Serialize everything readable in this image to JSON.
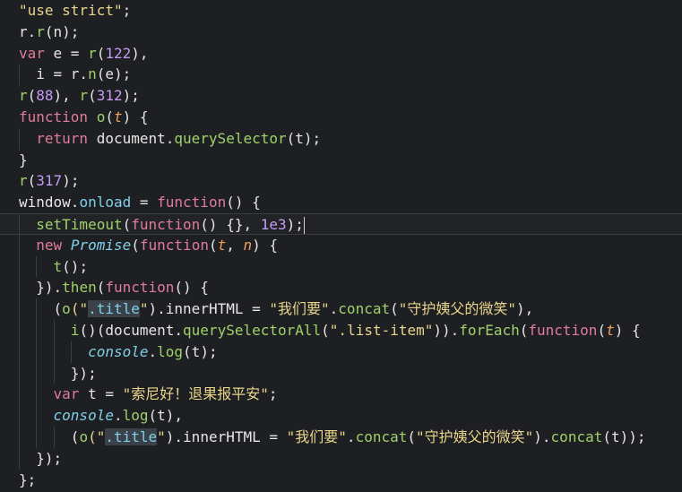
{
  "colors": {
    "background": "#1e1f22",
    "plain": "#e6e6e6",
    "keyword": "#e07c9b",
    "string": "#e8d58b",
    "number": "#c49bf2",
    "function": "#9fd26a",
    "property": "#7fd0e8",
    "param": "#f0a25b",
    "builtin": "#7fd0e8"
  },
  "editor": {
    "current_line_index": 10,
    "lines": [
      {
        "indent": 0,
        "tokens": [
          [
            "\"use strict\"",
            "string"
          ],
          [
            ";",
            "plain"
          ]
        ]
      },
      {
        "indent": 0,
        "tokens": [
          [
            "r.",
            "plain"
          ],
          [
            "r",
            "function"
          ],
          [
            "(n);",
            "plain"
          ]
        ]
      },
      {
        "indent": 0,
        "tokens": [
          [
            "var",
            "keyword"
          ],
          [
            " e = ",
            "plain"
          ],
          [
            "r",
            "function"
          ],
          [
            "(",
            "plain"
          ],
          [
            "122",
            "number"
          ],
          [
            "),",
            "plain"
          ]
        ]
      },
      {
        "indent": 1,
        "tokens": [
          [
            "  i = r.",
            "plain"
          ],
          [
            "n",
            "function"
          ],
          [
            "(e);",
            "plain"
          ]
        ]
      },
      {
        "indent": 0,
        "tokens": [
          [
            "r",
            "function"
          ],
          [
            "(",
            "plain"
          ],
          [
            "88",
            "number"
          ],
          [
            "), ",
            "plain"
          ],
          [
            "r",
            "function"
          ],
          [
            "(",
            "plain"
          ],
          [
            "312",
            "number"
          ],
          [
            ");",
            "plain"
          ]
        ]
      },
      {
        "indent": 0,
        "tokens": [
          [
            "function",
            "keyword"
          ],
          [
            " ",
            "plain"
          ],
          [
            "o",
            "function"
          ],
          [
            "(",
            "plain"
          ],
          [
            "t",
            "param"
          ],
          [
            ") {",
            "plain"
          ]
        ]
      },
      {
        "indent": 1,
        "tokens": [
          [
            "  ",
            "plain"
          ],
          [
            "return",
            "keyword"
          ],
          [
            " document.",
            "plain"
          ],
          [
            "querySelector",
            "function"
          ],
          [
            "(t);",
            "plain"
          ]
        ]
      },
      {
        "indent": 0,
        "tokens": [
          [
            "}",
            "plain"
          ]
        ]
      },
      {
        "indent": 0,
        "tokens": [
          [
            "r",
            "function"
          ],
          [
            "(",
            "plain"
          ],
          [
            "317",
            "number"
          ],
          [
            ");",
            "plain"
          ]
        ]
      },
      {
        "indent": 0,
        "tokens": [
          [
            "window.",
            "plain"
          ],
          [
            "onload",
            "property"
          ],
          [
            " = ",
            "plain"
          ],
          [
            "function",
            "keyword"
          ],
          [
            "() {",
            "plain"
          ]
        ]
      },
      {
        "indent": 1,
        "tokens": [
          [
            "  ",
            "plain"
          ],
          [
            "setTimeout",
            "function"
          ],
          [
            "(",
            "plain"
          ],
          [
            "function",
            "keyword"
          ],
          [
            "() {}, ",
            "plain"
          ],
          [
            "1e3",
            "number"
          ],
          [
            ");",
            "plain"
          ],
          [
            "|",
            "caret"
          ]
        ]
      },
      {
        "indent": 1,
        "tokens": [
          [
            "  ",
            "plain"
          ],
          [
            "new",
            "keyword"
          ],
          [
            " ",
            "plain"
          ],
          [
            "Promise",
            "builtin"
          ],
          [
            "(",
            "plain"
          ],
          [
            "function",
            "keyword"
          ],
          [
            "(",
            "plain"
          ],
          [
            "t",
            "param"
          ],
          [
            ", ",
            "plain"
          ],
          [
            "n",
            "param"
          ],
          [
            ") {",
            "plain"
          ]
        ]
      },
      {
        "indent": 2,
        "tokens": [
          [
            "    ",
            "plain"
          ],
          [
            "t",
            "function"
          ],
          [
            "();",
            "plain"
          ]
        ]
      },
      {
        "indent": 1,
        "tokens": [
          [
            "  }).",
            "plain"
          ],
          [
            "then",
            "function"
          ],
          [
            "(",
            "plain"
          ],
          [
            "function",
            "keyword"
          ],
          [
            "() {",
            "plain"
          ]
        ]
      },
      {
        "indent": 2,
        "tokens": [
          [
            "    (",
            "plain"
          ],
          [
            "o",
            "function"
          ],
          [
            "(\"",
            "string"
          ],
          [
            ".title",
            "sel"
          ],
          [
            "\"",
            "string"
          ],
          [
            ").innerHTML = ",
            "plain"
          ],
          [
            "\"我们要\"",
            "string"
          ],
          [
            ".",
            "plain"
          ],
          [
            "concat",
            "function"
          ],
          [
            "(",
            "plain"
          ],
          [
            "\"守护姨父的微笑\"",
            "string"
          ],
          [
            "),",
            "plain"
          ]
        ]
      },
      {
        "indent": 3,
        "tokens": [
          [
            "      ",
            "plain"
          ],
          [
            "i",
            "function"
          ],
          [
            "()(document.",
            "plain"
          ],
          [
            "querySelectorAll",
            "function"
          ],
          [
            "(",
            "plain"
          ],
          [
            "\".list-item\"",
            "string"
          ],
          [
            ")).",
            "plain"
          ],
          [
            "forEach",
            "function"
          ],
          [
            "(",
            "plain"
          ],
          [
            "function",
            "keyword"
          ],
          [
            "(",
            "plain"
          ],
          [
            "t",
            "param"
          ],
          [
            ") {",
            "plain"
          ]
        ]
      },
      {
        "indent": 4,
        "tokens": [
          [
            "        ",
            "plain"
          ],
          [
            "console",
            "builtin"
          ],
          [
            ".",
            "plain"
          ],
          [
            "log",
            "function"
          ],
          [
            "(t);",
            "plain"
          ]
        ]
      },
      {
        "indent": 3,
        "tokens": [
          [
            "      });",
            "plain"
          ]
        ]
      },
      {
        "indent": 2,
        "tokens": [
          [
            "    ",
            "plain"
          ],
          [
            "var",
            "keyword"
          ],
          [
            " t = ",
            "plain"
          ],
          [
            "\"索尼好！退果报平安\"",
            "string"
          ],
          [
            ";",
            "plain"
          ]
        ]
      },
      {
        "indent": 2,
        "tokens": [
          [
            "    ",
            "plain"
          ],
          [
            "console",
            "builtin"
          ],
          [
            ".",
            "plain"
          ],
          [
            "log",
            "function"
          ],
          [
            "(t),",
            "plain"
          ]
        ]
      },
      {
        "indent": 3,
        "tokens": [
          [
            "      (",
            "plain"
          ],
          [
            "o",
            "function"
          ],
          [
            "(\"",
            "string"
          ],
          [
            ".title",
            "sel"
          ],
          [
            "\"",
            "string"
          ],
          [
            ").innerHTML = ",
            "plain"
          ],
          [
            "\"我们要\"",
            "string"
          ],
          [
            ".",
            "plain"
          ],
          [
            "concat",
            "function"
          ],
          [
            "(",
            "plain"
          ],
          [
            "\"守护姨父的微笑\"",
            "string"
          ],
          [
            ").",
            "plain"
          ],
          [
            "concat",
            "function"
          ],
          [
            "(t));",
            "plain"
          ]
        ]
      },
      {
        "indent": 1,
        "tokens": [
          [
            "  });",
            "plain"
          ]
        ]
      },
      {
        "indent": 0,
        "tokens": [
          [
            "};",
            "plain"
          ]
        ]
      }
    ]
  }
}
